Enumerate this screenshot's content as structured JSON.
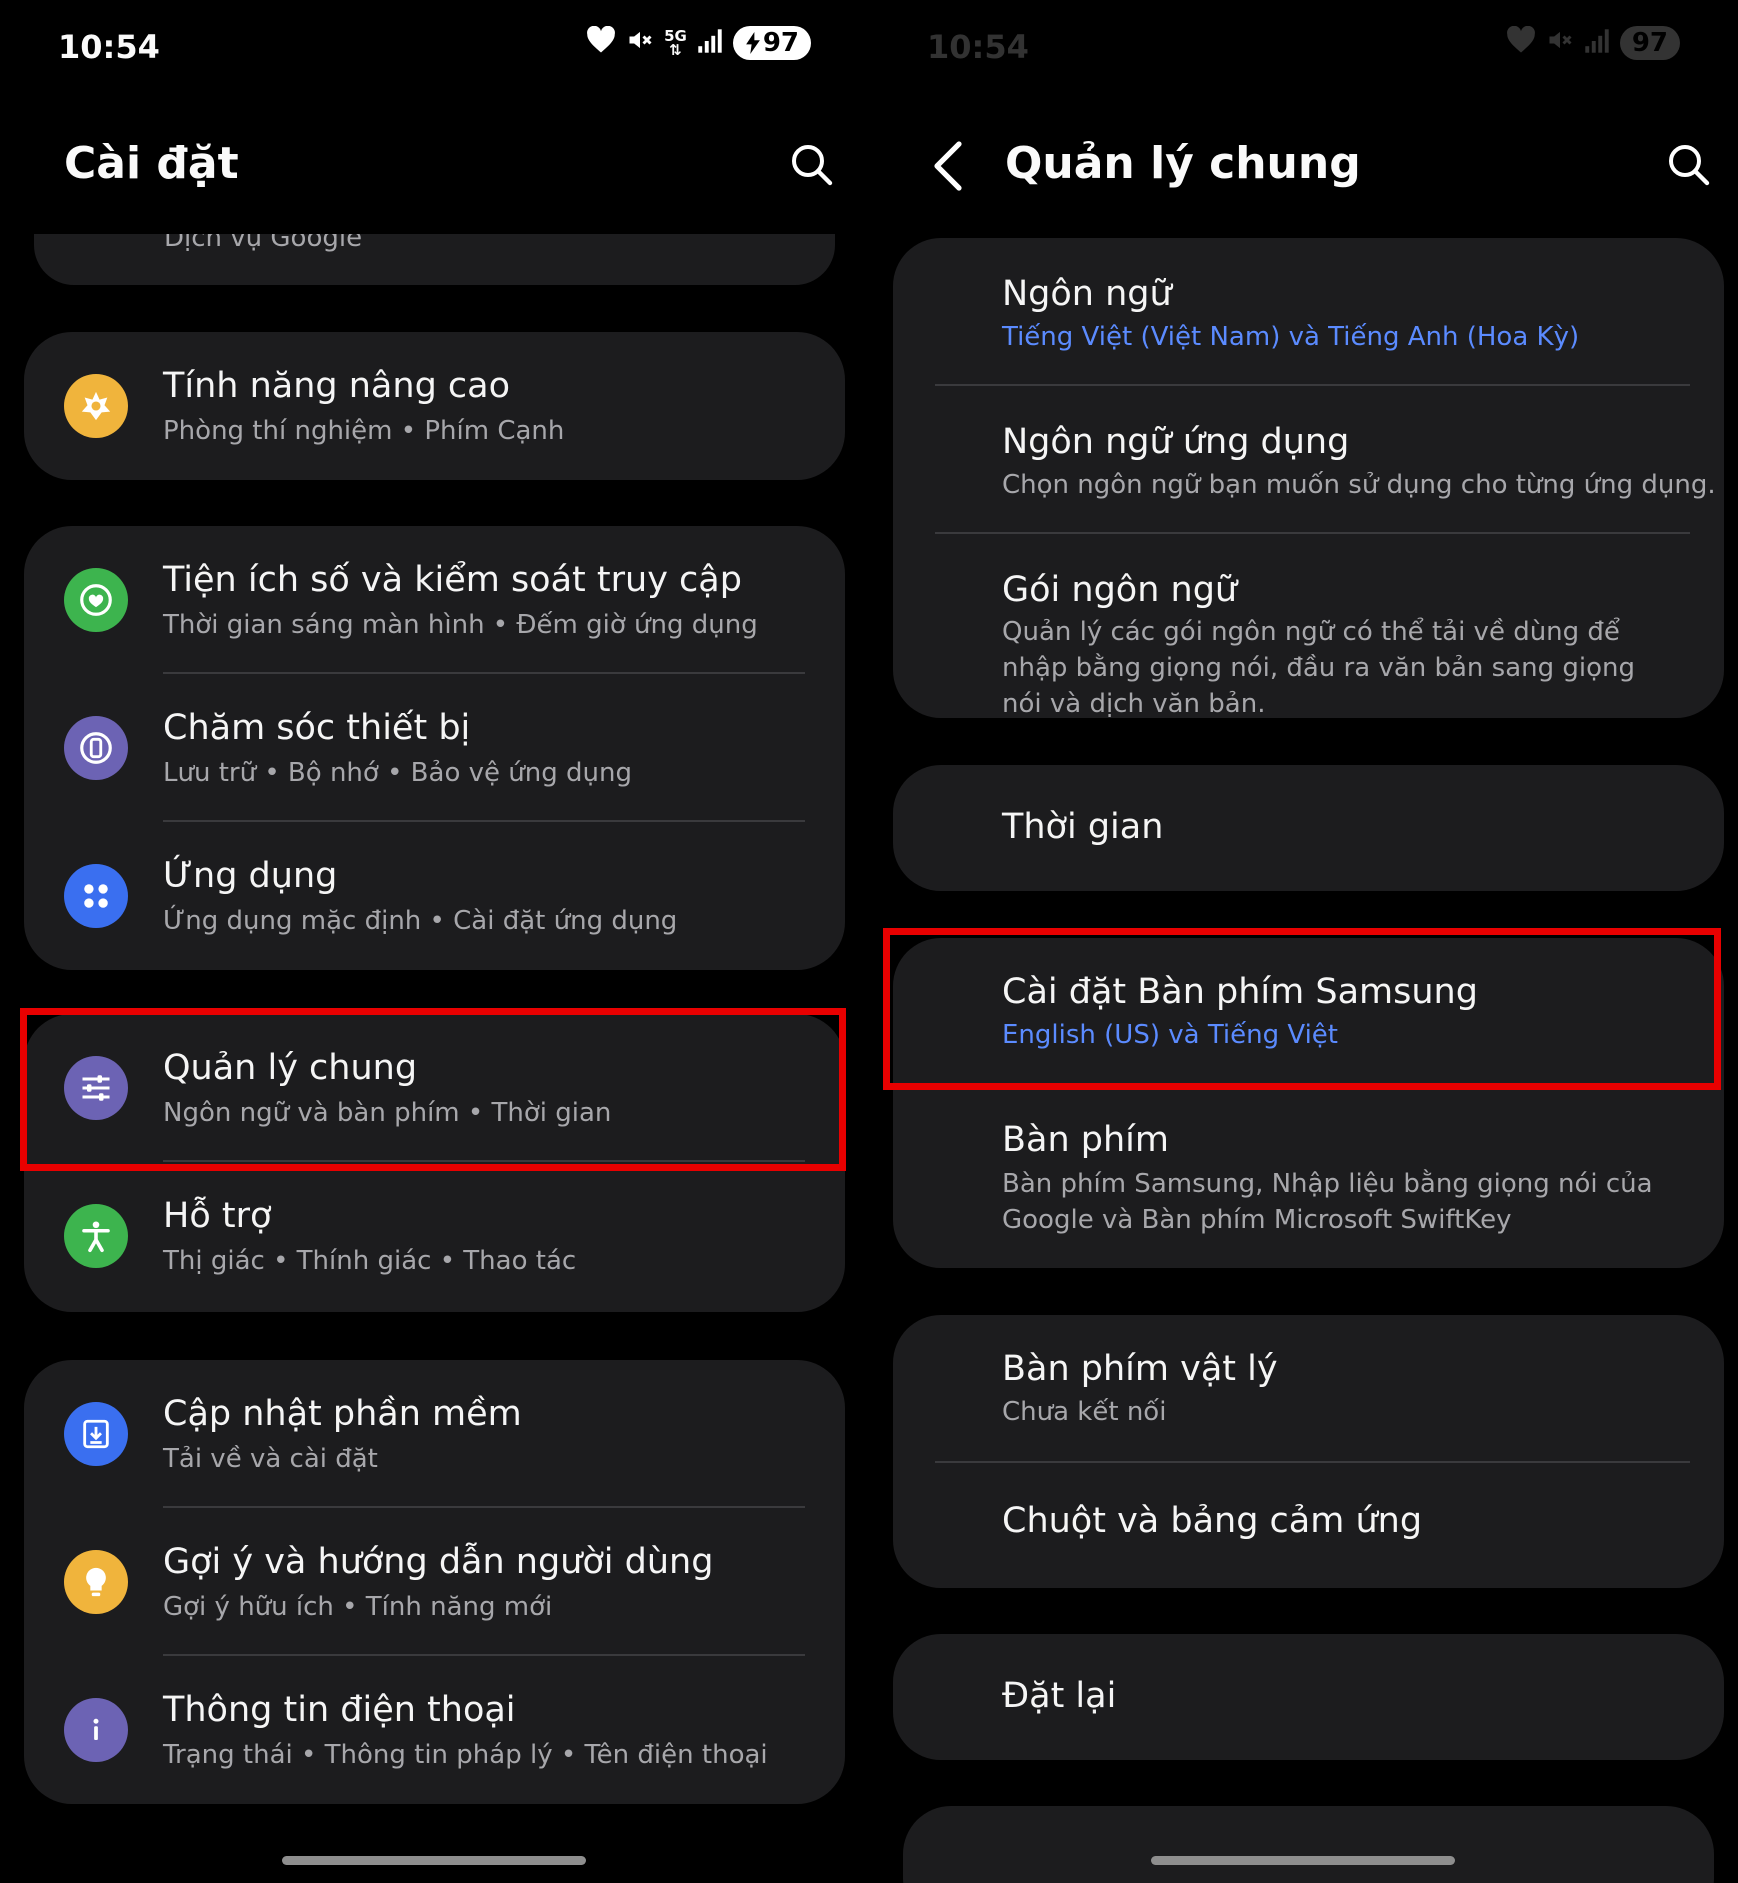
{
  "status": {
    "time": "10:54",
    "battery": "97",
    "network": "5G"
  },
  "left": {
    "title": "Cài đặt",
    "partial_item": "Dịch vụ Google",
    "group1": [
      {
        "title": "Tính năng nâng cao",
        "subtitle": "Phòng thí nghiệm  •  Phím Cạnh",
        "icon": "advanced-features-icon",
        "color": "#f0b43c"
      }
    ],
    "group2": [
      {
        "title": "Tiện ích số và kiểm soát truy cập",
        "subtitle": "Thời gian sáng màn hình  •  Đếm giờ ứng dụng",
        "icon": "digital-wellbeing-icon",
        "color": "#3db44e"
      },
      {
        "title": "Chăm sóc thiết bị",
        "subtitle": "Lưu trữ  •  Bộ nhớ  •  Bảo vệ ứng dụng",
        "icon": "device-care-icon",
        "color": "#6c63b4"
      },
      {
        "title": "Ứng dụng",
        "subtitle": "Ứng dụng mặc định  •  Cài đặt ứng dụng",
        "icon": "apps-icon",
        "color": "#3a6ff0"
      }
    ],
    "group3": [
      {
        "title": "Quản lý chung",
        "subtitle": "Ngôn ngữ và bàn phím  •  Thời gian",
        "icon": "general-management-icon",
        "color": "#6c63b4"
      },
      {
        "title": "Hỗ trợ",
        "subtitle": "Thị giác  •  Thính giác  •  Thao tác",
        "icon": "accessibility-icon",
        "color": "#3db44e"
      }
    ],
    "group4": [
      {
        "title": "Cập nhật phần mềm",
        "subtitle": "Tải về và cài đặt",
        "icon": "software-update-icon",
        "color": "#3a6ff0"
      },
      {
        "title": "Gợi ý và hướng dẫn người dùng",
        "subtitle": "Gợi ý hữu ích  •  Tính năng mới",
        "icon": "tips-icon",
        "color": "#f0b43c"
      },
      {
        "title": "Thông tin điện thoại",
        "subtitle": "Trạng thái  •  Thông tin pháp lý  •  Tên điện thoại",
        "icon": "about-phone-icon",
        "color": "#6c63b4"
      }
    ]
  },
  "right": {
    "title": "Quản lý chung",
    "group1": [
      {
        "title": "Ngôn ngữ",
        "subtitle": "Tiếng Việt (Việt Nam) và Tiếng Anh (Hoa Kỳ)",
        "accent": true
      },
      {
        "title": "Ngôn ngữ ứng dụng",
        "subtitle": "Chọn ngôn ngữ bạn muốn sử dụng cho từng ứng dụng."
      },
      {
        "title": "Gói ngôn ngữ",
        "subtitle": "Quản lý các gói ngôn ngữ có thể tải về dùng để nhập bằng giọng nói, đầu ra văn bản sang giọng nói và dịch văn bản."
      }
    ],
    "group2": [
      {
        "title": "Thời gian"
      }
    ],
    "group3": [
      {
        "title": "Cài đặt Bàn phím Samsung",
        "subtitle": "English (US) và Tiếng Việt",
        "accent": true
      },
      {
        "title": "Bàn phím",
        "subtitle": "Bàn phím Samsung, Nhập liệu bằng giọng nói của Google và Bàn phím Microsoft SwiftKey"
      }
    ],
    "group4": [
      {
        "title": "Bàn phím vật lý",
        "subtitle": "Chưa kết nối"
      },
      {
        "title": "Chuột và bảng cảm ứng"
      }
    ],
    "group5": [
      {
        "title": "Đặt lại"
      }
    ]
  },
  "colors": {
    "highlight": "#e80000",
    "accent_text": "#5b8bff",
    "card": "#1c1c1e"
  }
}
